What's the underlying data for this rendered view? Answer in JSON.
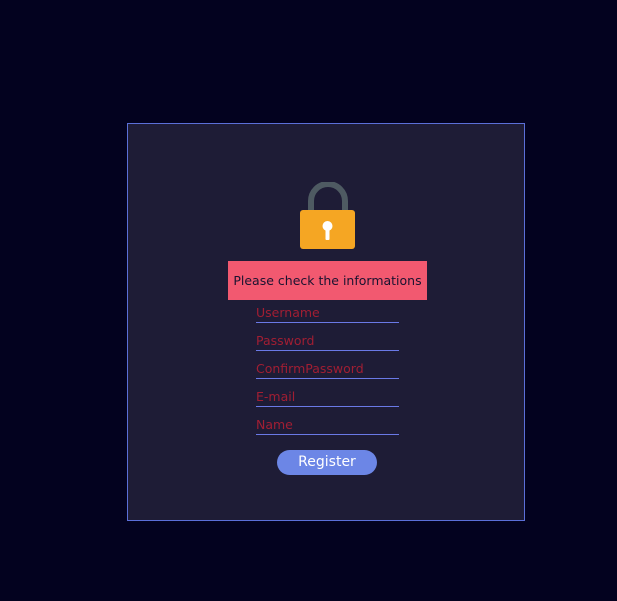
{
  "form": {
    "lock_icon": "padlock-icon",
    "error_message": "Please check the informations",
    "fields": [
      {
        "placeholder": "Username",
        "value": ""
      },
      {
        "placeholder": "Password",
        "value": ""
      },
      {
        "placeholder": "ConfirmPassword",
        "value": ""
      },
      {
        "placeholder": "E-mail",
        "value": ""
      },
      {
        "placeholder": "Name",
        "value": ""
      }
    ],
    "register_label": "Register"
  },
  "colors": {
    "background": "#03021f",
    "panel": "#1e1c36",
    "panel_border": "#5b6fd8",
    "error_banner": "#f25970",
    "placeholder_text": "#a11e33",
    "field_underline": "#6a79e6",
    "button": "#6c86e6",
    "lock_body": "#f5a623",
    "lock_shackle": "#4e5a62"
  }
}
